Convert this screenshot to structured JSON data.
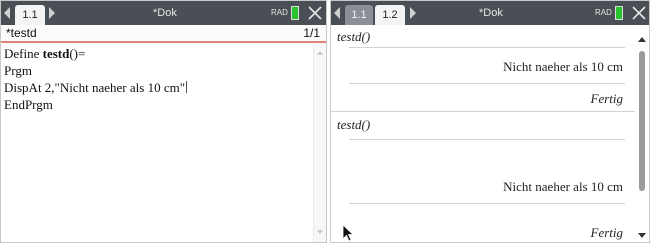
{
  "left_pane": {
    "tabs": [
      {
        "label": "1.1",
        "active": true
      }
    ],
    "document_title": "*Dok",
    "mode": "RAD",
    "program": {
      "name": "*testd",
      "page": "1/1"
    },
    "code": {
      "line1_prefix": "Define ",
      "line1_name": "testd",
      "line1_suffix": "()=",
      "line2": "Prgm",
      "line3": "DispAt 2,\"Nicht naeher als 10 cm\"",
      "line4": "EndPrgm"
    }
  },
  "right_pane": {
    "tabs": [
      {
        "label": "1.1",
        "active": false
      },
      {
        "label": "1.2",
        "active": true
      }
    ],
    "document_title": "*Dok",
    "mode": "RAD",
    "history": [
      {
        "entry": "testd()",
        "output": "Nicht naeher als 10 cm",
        "status": "Fertig"
      },
      {
        "entry": "testd()",
        "output": "Nicht naeher als 10 cm",
        "status": "Fertig"
      }
    ]
  },
  "colors": {
    "toolbar": "#4a4f55",
    "active_tab": "#f4f4f4",
    "inactive_tab": "#8b9096",
    "battery": "#27c42c",
    "header_underline": "#e0837a"
  },
  "icons": {
    "nav_prev": "triangle-left-icon",
    "nav_next": "triangle-right-icon",
    "battery": "battery-icon",
    "close": "close-icon",
    "pointer": "mouse-pointer-icon"
  }
}
